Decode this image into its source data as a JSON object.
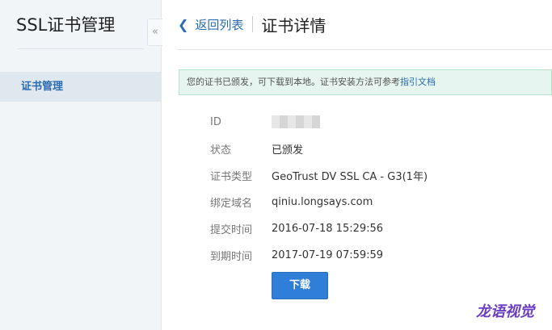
{
  "sidebar": {
    "title": "SSL证书管理",
    "collapse_label": "«",
    "items": [
      {
        "label": "证书管理",
        "active": true
      }
    ]
  },
  "header": {
    "back_label": "返回列表",
    "back_icon": "chevron-left-icon",
    "title": "证书详情"
  },
  "notice": {
    "text": "您的证书已颁发，可下载到本地。证书安装方法可参考",
    "link_label": "指引文档"
  },
  "details": [
    {
      "label": "ID",
      "value": ""
    },
    {
      "label": "状态",
      "value": "已颁发"
    },
    {
      "label": "证书类型",
      "value": "GeoTrust DV SSL CA - G3(1年)"
    },
    {
      "label": "绑定域名",
      "value": "qiniu.longsays.com"
    },
    {
      "label": "提交时间",
      "value": "2016-07-18 15:29:56"
    },
    {
      "label": "到期时间",
      "value": "2017-07-19 07:59:59"
    }
  ],
  "actions": {
    "download_label": "下载"
  },
  "watermark": "龙语视觉",
  "colors": {
    "accent": "#2f7fd8",
    "link": "#2b6cb0",
    "notice_bg": "#e6f5ef",
    "sidebar_bg": "#f2f5f8"
  }
}
